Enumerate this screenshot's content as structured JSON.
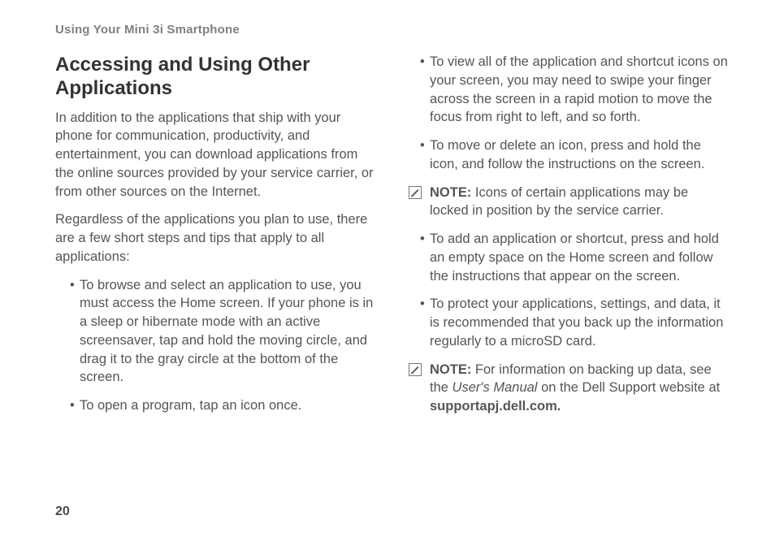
{
  "runningHead": "Using Your Mini 3i Smartphone",
  "title": "Accessing and Using Other Applications",
  "intro1": "In addition to the applications that ship with your phone for communication, productivity, and entertainment, you can download applications from the online sources provided by your service carrier, or from other sources on the Internet.",
  "intro2": "Regardless of the applications you plan to use, there are a few short steps and tips that apply to all applications:",
  "leftBullets": [
    "To browse and select an application to use, you must access the Home screen. If your phone is in a sleep or hibernate mode with an active screensaver, tap and hold the moving circle, and drag it to the gray circle at the bottom of the screen.",
    "To open a program, tap an icon once."
  ],
  "rightBullets1": [
    "To view all of the application and shortcut icons on your screen, you may need to swipe your finger across the screen in a rapid motion to move the focus from right to left, and so forth.",
    "To move or delete an icon, press and hold the icon, and follow the instructions on the screen."
  ],
  "note1": {
    "label": "NOTE:",
    "text": " Icons of certain applications may be locked in position by the service carrier."
  },
  "rightBullets2": [
    "To add an application or shortcut, press and hold an empty space on the Home screen and follow the instructions that appear on the screen.",
    "To protect your applications, settings, and data, it is recommended that you back up the information regularly to a microSD card."
  ],
  "note2": {
    "label": "NOTE:",
    "pre": " For information on backing up data, see the ",
    "italic": "User's Manual",
    "mid": " on the Dell Support website at ",
    "bold": "supportapj.dell.com."
  },
  "pageNumber": "20"
}
